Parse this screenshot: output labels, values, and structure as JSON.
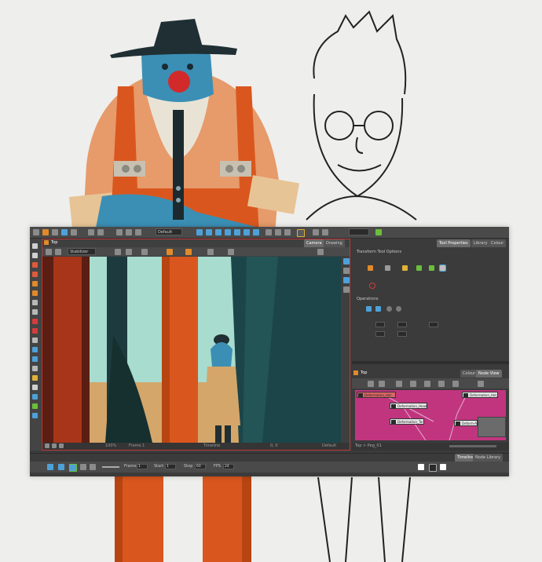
{
  "toolbar": {
    "layout_dropdown": "Default"
  },
  "camera_view": {
    "breadcrumb": "Top",
    "tabs": [
      {
        "label": "Camera"
      },
      {
        "label": "Drawing"
      }
    ],
    "mode_dropdown": "Stabilizer Off",
    "status_bar": {
      "zoom": "100%",
      "frame": "Frame 1",
      "mode": "Timeline",
      "coords": "0, 0",
      "view": "Default"
    }
  },
  "tool_properties": {
    "tabs": [
      {
        "label": "Tool Properties"
      },
      {
        "label": "Library"
      },
      {
        "label": "Colour"
      }
    ],
    "section_transform": "Transform Tool Options",
    "section_operations": "Operations"
  },
  "node_view": {
    "breadcrumb": "Top",
    "tabs": [
      {
        "label": "Colour"
      },
      {
        "label": "Node View"
      }
    ],
    "nodes": [
      {
        "label": "Deformation_Hat"
      },
      {
        "label": "Deformation_Head"
      },
      {
        "label": "Deformation_Hat_R"
      },
      {
        "label": "Deformation_Torso"
      },
      {
        "label": "Deform-Arm_L"
      }
    ],
    "footer": "Top > Peg_01"
  },
  "timeline": {
    "tabs": [
      {
        "label": "Timeline"
      },
      {
        "label": "Node Library"
      }
    ],
    "fields": [
      {
        "label": "Frame",
        "value": "1"
      },
      {
        "label": "Start",
        "value": "1"
      },
      {
        "label": "Stop",
        "value": "60"
      },
      {
        "label": "FPS",
        "value": "24"
      }
    ]
  },
  "colors": {
    "node_view_bg": "#c1357f",
    "app_bg": "#3b3b3b",
    "accent_red": "#c0393b"
  }
}
